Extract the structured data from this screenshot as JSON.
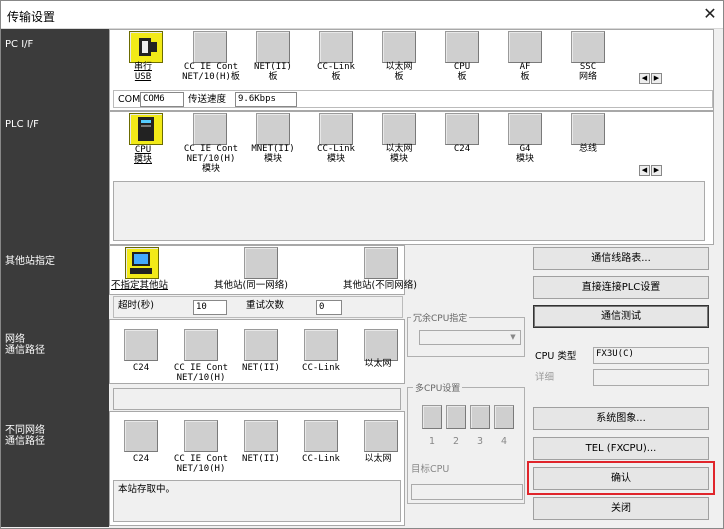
{
  "window": {
    "title": "传输设置",
    "close_glyph": "✕"
  },
  "sidebar": {
    "pc_if": "PC I/F",
    "plc_if": "PLC I/F",
    "other_station": "其他站指定",
    "network_route": "网络\n通信路径",
    "diff_network_route": "不同网络\n通信路径"
  },
  "pc_if": {
    "items": [
      {
        "label": "串行\nUSB"
      },
      {
        "label": "CC IE Cont\nNET/10(H)板"
      },
      {
        "label": "NET(II)\n板"
      },
      {
        "label": "CC-Link\n板"
      },
      {
        "label": "以太网\n板"
      },
      {
        "label": "CPU\n板"
      },
      {
        "label": "AF\n板"
      },
      {
        "label": "SSC\n网络"
      }
    ],
    "com_label": "COM",
    "com_value": "COM6",
    "speed_label": "传送速度",
    "speed_value": "9.6Kbps"
  },
  "plc_if": {
    "items": [
      {
        "label": "CPU\n模块"
      },
      {
        "label": "CC IE Cont\nNET/10(H)\n模块"
      },
      {
        "label": "MNET(II)\n模块"
      },
      {
        "label": "CC-Link\n模块"
      },
      {
        "label": "以太网\n模块"
      },
      {
        "label": "C24"
      },
      {
        "label": "G4\n模块"
      },
      {
        "label": "总线"
      }
    ]
  },
  "other_station": {
    "items": [
      {
        "label": "不指定其他站"
      },
      {
        "label": "其他站(同一网络)"
      },
      {
        "label": "其他站(不同网络)"
      }
    ],
    "timeout_label": "超时(秒)",
    "timeout_value": "10",
    "retry_label": "重试次数",
    "retry_value": "0"
  },
  "network_route": {
    "items": [
      {
        "label": "C24"
      },
      {
        "label": "CC IE Cont\nNET/10(H)"
      },
      {
        "label": "NET(II)"
      },
      {
        "label": "CC-Link"
      },
      {
        "label": "以太网"
      }
    ]
  },
  "diff_network_route": {
    "items": [
      {
        "label": "C24"
      },
      {
        "label": "CC IE Cont\nNET/10(H)"
      },
      {
        "label": "NET(II)"
      },
      {
        "label": "CC-Link"
      },
      {
        "label": "以太网"
      }
    ],
    "status": "本站存取中。"
  },
  "redundant": {
    "label": "冗余CPU指定"
  },
  "multi_cpu": {
    "label": "多CPU设置",
    "nums": [
      "1",
      "2",
      "3",
      "4"
    ],
    "target_label": "目标CPU"
  },
  "right": {
    "route_list": "通信线路表...",
    "direct_plc": "直接连接PLC设置",
    "comm_test": "通信测试",
    "cpu_type_label": "CPU 类型",
    "cpu_type_value": "FX3U(C)",
    "detail_label": "详细",
    "system_image": "系统图象...",
    "tel": "TEL (FXCPU)...",
    "confirm": "确认",
    "close": "关闭"
  }
}
